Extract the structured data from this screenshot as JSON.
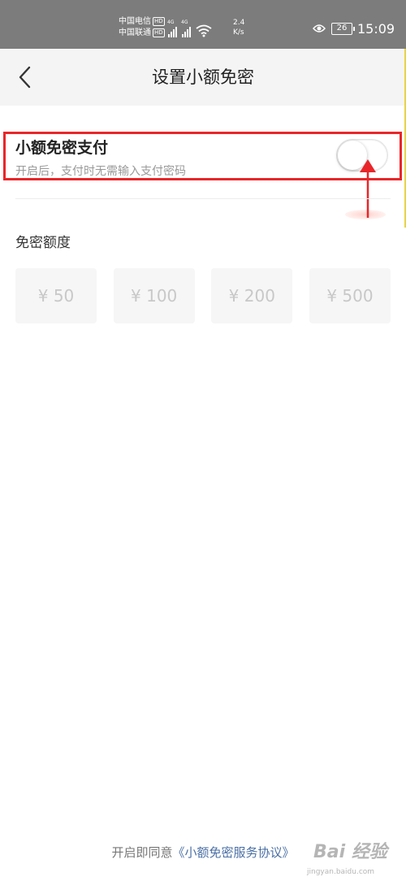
{
  "status_bar": {
    "carrier_1": "中国电信",
    "carrier_2": "中国联通",
    "hd_badge": "HD",
    "network": "4G",
    "speed_value": "2.4",
    "speed_unit": "K/s",
    "battery": "26",
    "time": "15:09"
  },
  "nav": {
    "title": "设置小额免密",
    "back_icon": "chevron-left-icon"
  },
  "setting": {
    "title": "小额免密支付",
    "description": "开启后，支付时无需输入支付密码",
    "enabled": false
  },
  "limit": {
    "label": "免密额度",
    "options": [
      "¥ 50",
      "¥ 100",
      "¥ 200",
      "¥ 500"
    ]
  },
  "footer": {
    "agreement_prefix": "开启即同意",
    "agreement_link": "《小额免密服务协议》"
  },
  "watermark": {
    "brand": "Bai 经验",
    "sub": "jingyan.baidu.com"
  },
  "colors": {
    "highlight": "#e8262a",
    "status_bar": "#7c7c7c",
    "link": "#4a6fa5"
  }
}
